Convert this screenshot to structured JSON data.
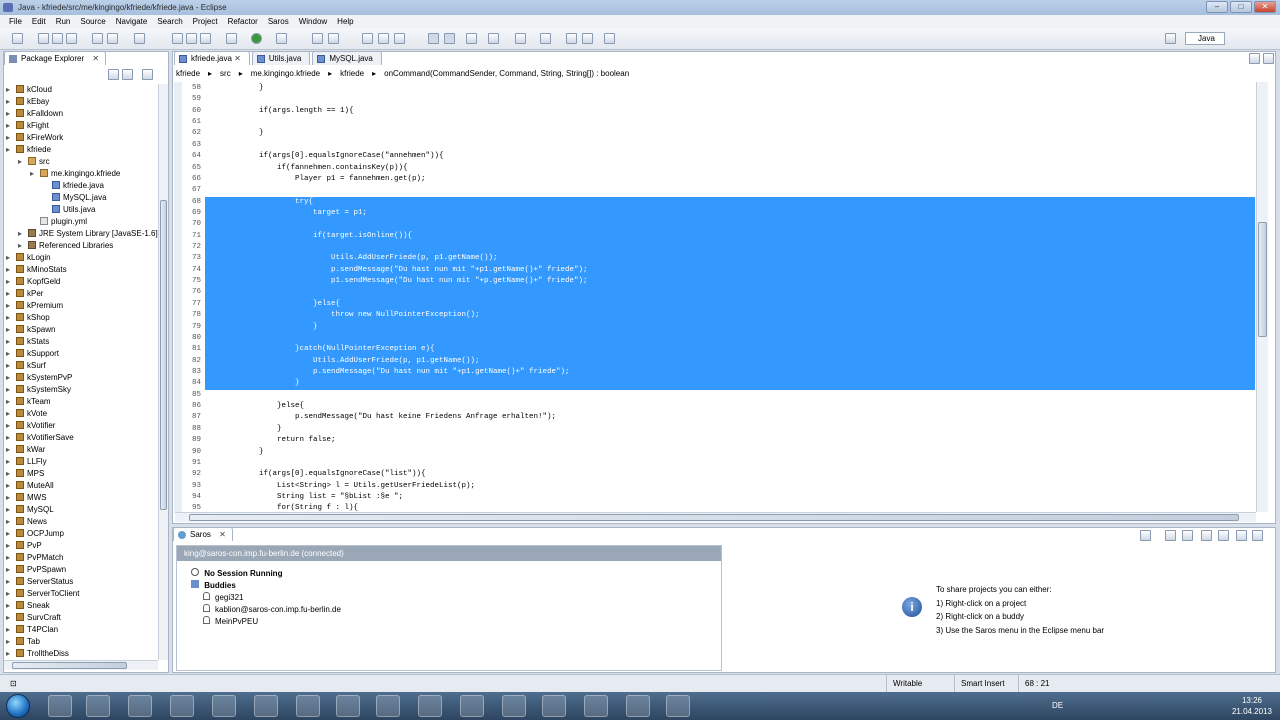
{
  "window": {
    "title": "Java - kfriede/src/me/kingingo/kfriede/kfriede.java - Eclipse"
  },
  "menu": [
    "File",
    "Edit",
    "Run",
    "Source",
    "Navigate",
    "Search",
    "Project",
    "Refactor",
    "Saros",
    "Window",
    "Help"
  ],
  "perspective": "Java",
  "package_explorer": {
    "title": "Package Explorer",
    "items": [
      {
        "label": "kCloud",
        "depth": 0,
        "kind": "proj"
      },
      {
        "label": "kEbay",
        "depth": 0,
        "kind": "proj"
      },
      {
        "label": "kFalldown",
        "depth": 0,
        "kind": "proj"
      },
      {
        "label": "kFight",
        "depth": 0,
        "kind": "proj"
      },
      {
        "label": "kFireWork",
        "depth": 0,
        "kind": "proj"
      },
      {
        "label": "kfriede",
        "depth": 0,
        "kind": "proj"
      },
      {
        "label": "src",
        "depth": 1,
        "kind": "pkg"
      },
      {
        "label": "me.kingingo.kfriede",
        "depth": 2,
        "kind": "pkg"
      },
      {
        "label": "kfriede.java",
        "depth": 3,
        "kind": "jfile"
      },
      {
        "label": "MySQL.java",
        "depth": 3,
        "kind": "jfile"
      },
      {
        "label": "Utils.java",
        "depth": 3,
        "kind": "jfile"
      },
      {
        "label": "plugin.yml",
        "depth": 2,
        "kind": "xmlf"
      },
      {
        "label": "JRE System Library [JavaSE-1.6]",
        "depth": 1,
        "kind": "libf"
      },
      {
        "label": "Referenced Libraries",
        "depth": 1,
        "kind": "libf"
      },
      {
        "label": "kLogin",
        "depth": 0,
        "kind": "proj"
      },
      {
        "label": "kMinoStats",
        "depth": 0,
        "kind": "proj"
      },
      {
        "label": "KopfGeld",
        "depth": 0,
        "kind": "proj"
      },
      {
        "label": "kPer",
        "depth": 0,
        "kind": "proj"
      },
      {
        "label": "kPremium",
        "depth": 0,
        "kind": "proj"
      },
      {
        "label": "kShop",
        "depth": 0,
        "kind": "proj"
      },
      {
        "label": "kSpawn",
        "depth": 0,
        "kind": "proj"
      },
      {
        "label": "kStats",
        "depth": 0,
        "kind": "proj"
      },
      {
        "label": "kSupport",
        "depth": 0,
        "kind": "proj"
      },
      {
        "label": "kSurf",
        "depth": 0,
        "kind": "proj"
      },
      {
        "label": "kSystemPvP",
        "depth": 0,
        "kind": "proj"
      },
      {
        "label": "kSystemSky",
        "depth": 0,
        "kind": "proj"
      },
      {
        "label": "kTeam",
        "depth": 0,
        "kind": "proj"
      },
      {
        "label": "kVote",
        "depth": 0,
        "kind": "proj"
      },
      {
        "label": "kVotifier",
        "depth": 0,
        "kind": "proj"
      },
      {
        "label": "kVotifierSave",
        "depth": 0,
        "kind": "proj"
      },
      {
        "label": "kWar",
        "depth": 0,
        "kind": "proj"
      },
      {
        "label": "LLFly",
        "depth": 0,
        "kind": "proj"
      },
      {
        "label": "MPS",
        "depth": 0,
        "kind": "proj"
      },
      {
        "label": "MuteAll",
        "depth": 0,
        "kind": "proj"
      },
      {
        "label": "MWS",
        "depth": 0,
        "kind": "proj"
      },
      {
        "label": "MySQL",
        "depth": 0,
        "kind": "proj"
      },
      {
        "label": "News",
        "depth": 0,
        "kind": "proj"
      },
      {
        "label": "OCPJump",
        "depth": 0,
        "kind": "proj"
      },
      {
        "label": "PvP",
        "depth": 0,
        "kind": "proj"
      },
      {
        "label": "PvPMatch",
        "depth": 0,
        "kind": "proj"
      },
      {
        "label": "PvPSpawn",
        "depth": 0,
        "kind": "proj"
      },
      {
        "label": "ServerStatus",
        "depth": 0,
        "kind": "proj"
      },
      {
        "label": "ServerToClient",
        "depth": 0,
        "kind": "proj"
      },
      {
        "label": "Sneak",
        "depth": 0,
        "kind": "proj"
      },
      {
        "label": "SurvCraft",
        "depth": 0,
        "kind": "proj"
      },
      {
        "label": "T4PClan",
        "depth": 0,
        "kind": "proj"
      },
      {
        "label": "Tab",
        "depth": 0,
        "kind": "proj"
      },
      {
        "label": "TrolltheDiss",
        "depth": 0,
        "kind": "proj"
      }
    ]
  },
  "editor": {
    "tabs": [
      "kfriede.java",
      "Utils.java",
      "MySQL.java"
    ],
    "breadcrumb": [
      "kfriede",
      "src",
      "me.kingingo.kfriede",
      "kfriede",
      "onCommand(CommandSender, Command, String, String[]) : boolean"
    ],
    "lines": [
      {
        "n": "58",
        "t": "            }",
        "sel": false
      },
      {
        "n": "59",
        "t": "",
        "sel": false
      },
      {
        "n": "60",
        "t": "            if(args.length == 1){",
        "sel": false
      },
      {
        "n": "61",
        "t": "",
        "sel": false
      },
      {
        "n": "62",
        "t": "            }",
        "sel": false
      },
      {
        "n": "63",
        "t": "",
        "sel": false
      },
      {
        "n": "64",
        "t": "            if(args[0].equalsIgnoreCase(\"annehmen\")){",
        "sel": false
      },
      {
        "n": "65",
        "t": "                if(fannehmen.containsKey(p)){",
        "sel": false
      },
      {
        "n": "66",
        "t": "                    Player p1 = fannehmen.get(p);",
        "sel": false
      },
      {
        "n": "67",
        "t": "",
        "sel": false
      },
      {
        "n": "68",
        "t": "                    try{",
        "sel": true
      },
      {
        "n": "69",
        "t": "                        target = p1;",
        "sel": true
      },
      {
        "n": "70",
        "t": "",
        "sel": true
      },
      {
        "n": "71",
        "t": "                        if(target.isOnline()){",
        "sel": true
      },
      {
        "n": "72",
        "t": "",
        "sel": true
      },
      {
        "n": "73",
        "t": "                            Utils.AddUserFriede(p, p1.getName());",
        "sel": true
      },
      {
        "n": "74",
        "t": "                            p.sendMessage(\"Du hast nun mit \"+p1.getName()+\" friede\");",
        "sel": true
      },
      {
        "n": "75",
        "t": "                            p1.sendMessage(\"Du hast nun mit \"+p.getName()+\" friede\");",
        "sel": true
      },
      {
        "n": "76",
        "t": "",
        "sel": true
      },
      {
        "n": "77",
        "t": "                        }else{",
        "sel": true
      },
      {
        "n": "78",
        "t": "                            throw new NullPointerException();",
        "sel": true
      },
      {
        "n": "79",
        "t": "                        }",
        "sel": true
      },
      {
        "n": "80",
        "t": "",
        "sel": true
      },
      {
        "n": "81",
        "t": "                    }catch(NullPointerException e){",
        "sel": true
      },
      {
        "n": "82",
        "t": "                        Utils.AddUserFriede(p, p1.getName());",
        "sel": true
      },
      {
        "n": "83",
        "t": "                        p.sendMessage(\"Du hast nun mit \"+p1.getName()+\" friede\");",
        "sel": true
      },
      {
        "n": "84",
        "t": "                    }",
        "sel": true
      },
      {
        "n": "85",
        "t": "",
        "sel": false
      },
      {
        "n": "86",
        "t": "                }else{",
        "sel": false
      },
      {
        "n": "87",
        "t": "                    p.sendMessage(\"Du hast keine Friedens Anfrage erhalten!\");",
        "sel": false
      },
      {
        "n": "88",
        "t": "                }",
        "sel": false
      },
      {
        "n": "89",
        "t": "                return false;",
        "sel": false
      },
      {
        "n": "90",
        "t": "            }",
        "sel": false
      },
      {
        "n": "91",
        "t": "",
        "sel": false
      },
      {
        "n": "92",
        "t": "            if(args[0].equalsIgnoreCase(\"list\")){",
        "sel": false
      },
      {
        "n": "93",
        "t": "                List<String> l = Utils.getUserFriedeList(p);",
        "sel": false
      },
      {
        "n": "94",
        "t": "                String list = \"§bList :§e \";",
        "sel": false
      },
      {
        "n": "95",
        "t": "                for(String f : l){",
        "sel": false
      }
    ]
  },
  "saros": {
    "title": "Saros",
    "connection": "king@saros-con.imp.fu-berlin.de (connected)",
    "session": "No Session Running",
    "buddies_label": "Buddies",
    "buddies": [
      "gegi321",
      "kablion@saros-con.imp.fu-berlin.de",
      "MeinPvPEU"
    ],
    "info_title": "To share projects you can either:",
    "info_steps": [
      "1) Right-click on a project",
      "2) Right-click on a buddy",
      "3) Use the Saros menu in the Eclipse menu bar"
    ]
  },
  "status": {
    "mode": "Writable",
    "insert": "Smart Insert",
    "pos": "68 : 21"
  },
  "taskbar": {
    "lang": "DE",
    "time": "13:26",
    "date": "21.04.2013"
  }
}
